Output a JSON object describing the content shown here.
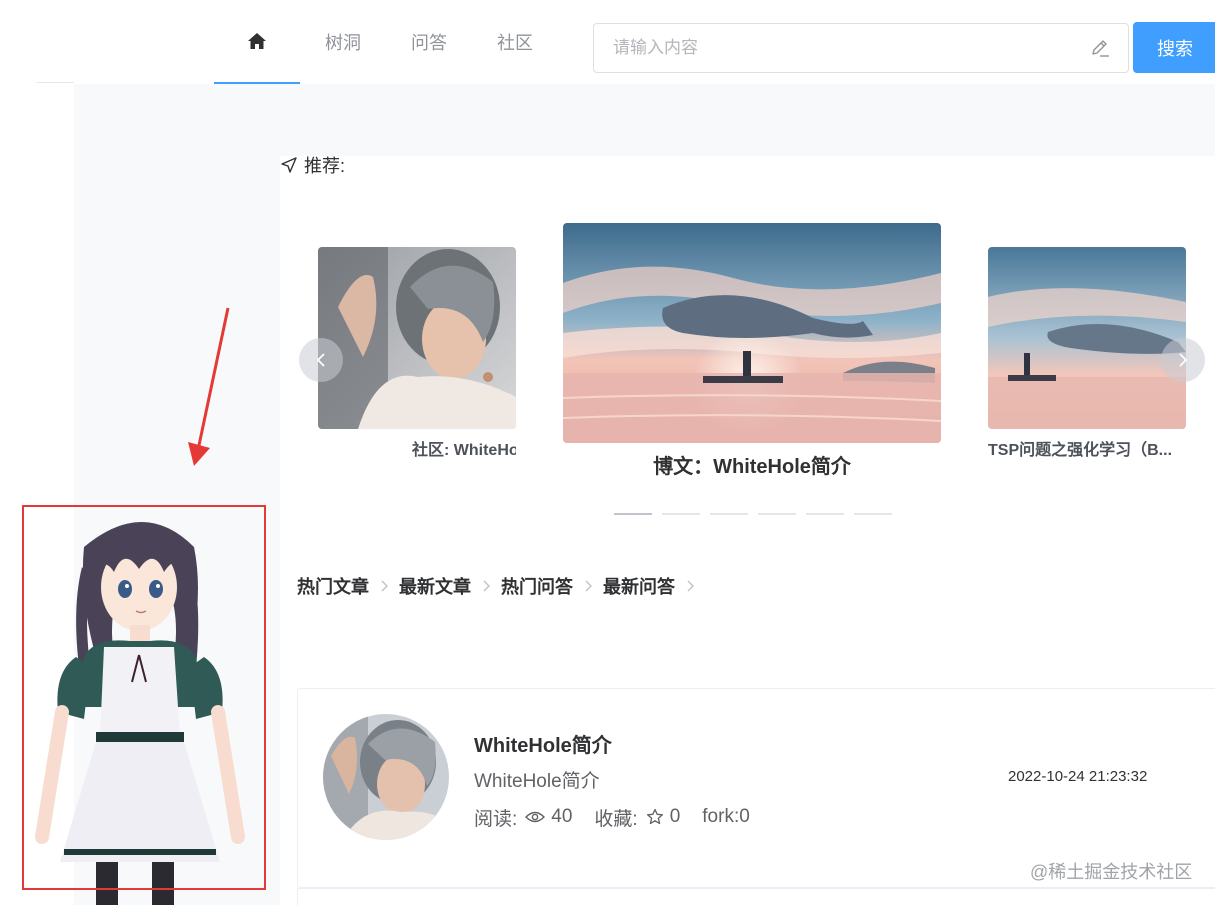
{
  "nav": {
    "tabs": [
      "树洞",
      "问答",
      "社区"
    ],
    "home_icon": "home-icon"
  },
  "search": {
    "placeholder": "请输入内容",
    "button_label": "搜索",
    "icon": "edit-icon"
  },
  "recommend": {
    "label": "推荐:",
    "icon": "send-icon",
    "cards": [
      {
        "caption": "社区: WhiteHo"
      },
      {
        "caption": "博文：WhiteHole简介"
      },
      {
        "caption": "TSP问题之强化学习（B..."
      }
    ],
    "indicator_count": 6,
    "active_indicator": 0
  },
  "tabs": {
    "items": [
      "热门文章",
      "最新文章",
      "热门问答",
      "最新问答"
    ]
  },
  "article": {
    "title": "WhiteHole简介",
    "subtitle": "WhiteHole简介",
    "time": "2022-10-24 21:23:32",
    "read_label": "阅读:",
    "read_count": "40",
    "fav_label": "收藏:",
    "fav_count": "0",
    "fork_text": "fork:0"
  },
  "watermark": "@稀土掘金技术社区",
  "colors": {
    "accent": "#409eff",
    "annotation_red": "#e53935"
  }
}
